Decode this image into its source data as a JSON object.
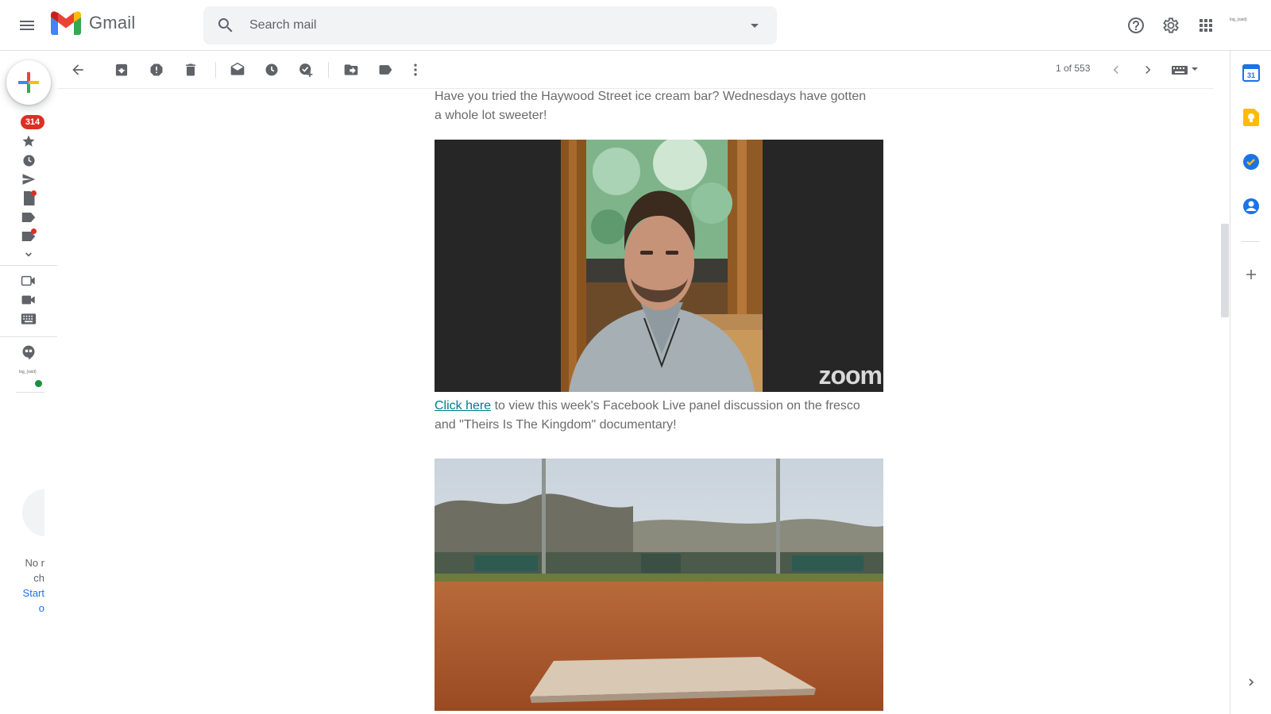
{
  "app": {
    "name": "Gmail",
    "account_label": "log_(ssid)"
  },
  "search": {
    "placeholder": "Search mail"
  },
  "rail": {
    "inbox_badge": "314",
    "hangouts_user": "log_(ssid)",
    "no_chats_line1": "No r",
    "no_chats_line2": "ch",
    "start_chat_line1": "Start",
    "start_chat_line2": "o"
  },
  "toolbar": {
    "pager": "1 of 553"
  },
  "email": {
    "paragraph1": "Have you tried the Haywood Street ice cream bar? Wednesdays have gotten a whole lot sweeter!",
    "video_watermark": "zoom",
    "link_text": "Click here",
    "paragraph2_rest": " to view this week's Facebook Live panel discussion on the fresco and \"Theirs Is The Kingdom\" documentary!"
  },
  "colors": {
    "badge": "#d93025",
    "link": "#007c89",
    "online": "#1e8e3e",
    "calendar_blue": "#1a73e8",
    "keep_yellow": "#fbbc04"
  },
  "icons": {
    "header": [
      "menu-icon",
      "gmail-logo",
      "search-icon",
      "search-options-icon",
      "help-icon",
      "settings-icon",
      "apps-icon"
    ],
    "toolbar": [
      "back-arrow-icon",
      "archive-icon",
      "report-spam-icon",
      "delete-icon",
      "mark-unread-icon",
      "snooze-icon",
      "add-to-tasks-icon",
      "move-to-icon",
      "label-icon",
      "more-icon",
      "chevron-left-icon",
      "chevron-right-icon",
      "input-tools-icon"
    ],
    "side_panel": [
      "calendar-icon",
      "keep-icon",
      "tasks-icon",
      "contacts-icon",
      "add-addon-icon",
      "expand-panel-icon"
    ]
  }
}
